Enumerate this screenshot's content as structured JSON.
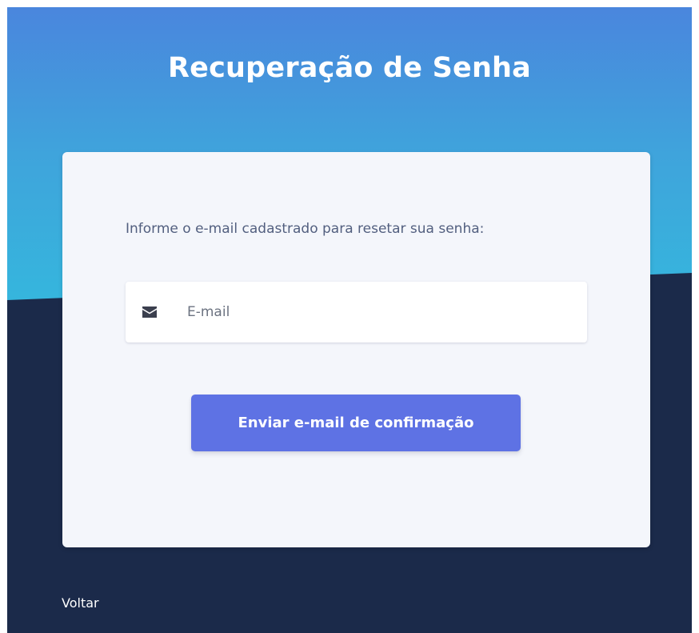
{
  "page": {
    "title": "Recuperação de Senha"
  },
  "form": {
    "instruction": "Informe o e-mail cadastrado para resetar sua senha:",
    "email": {
      "value": "",
      "placeholder": "E-mail",
      "icon": "envelope-icon"
    },
    "submit_label": "Enviar e-mail de confirmação"
  },
  "footer": {
    "back_label": "Voltar"
  },
  "colors": {
    "hero_top": "#4a86dd",
    "hero_bottom": "#35b6dd",
    "background_dark": "#1b2a4a",
    "card": "#f4f6fb",
    "button": "#5e72e4"
  }
}
